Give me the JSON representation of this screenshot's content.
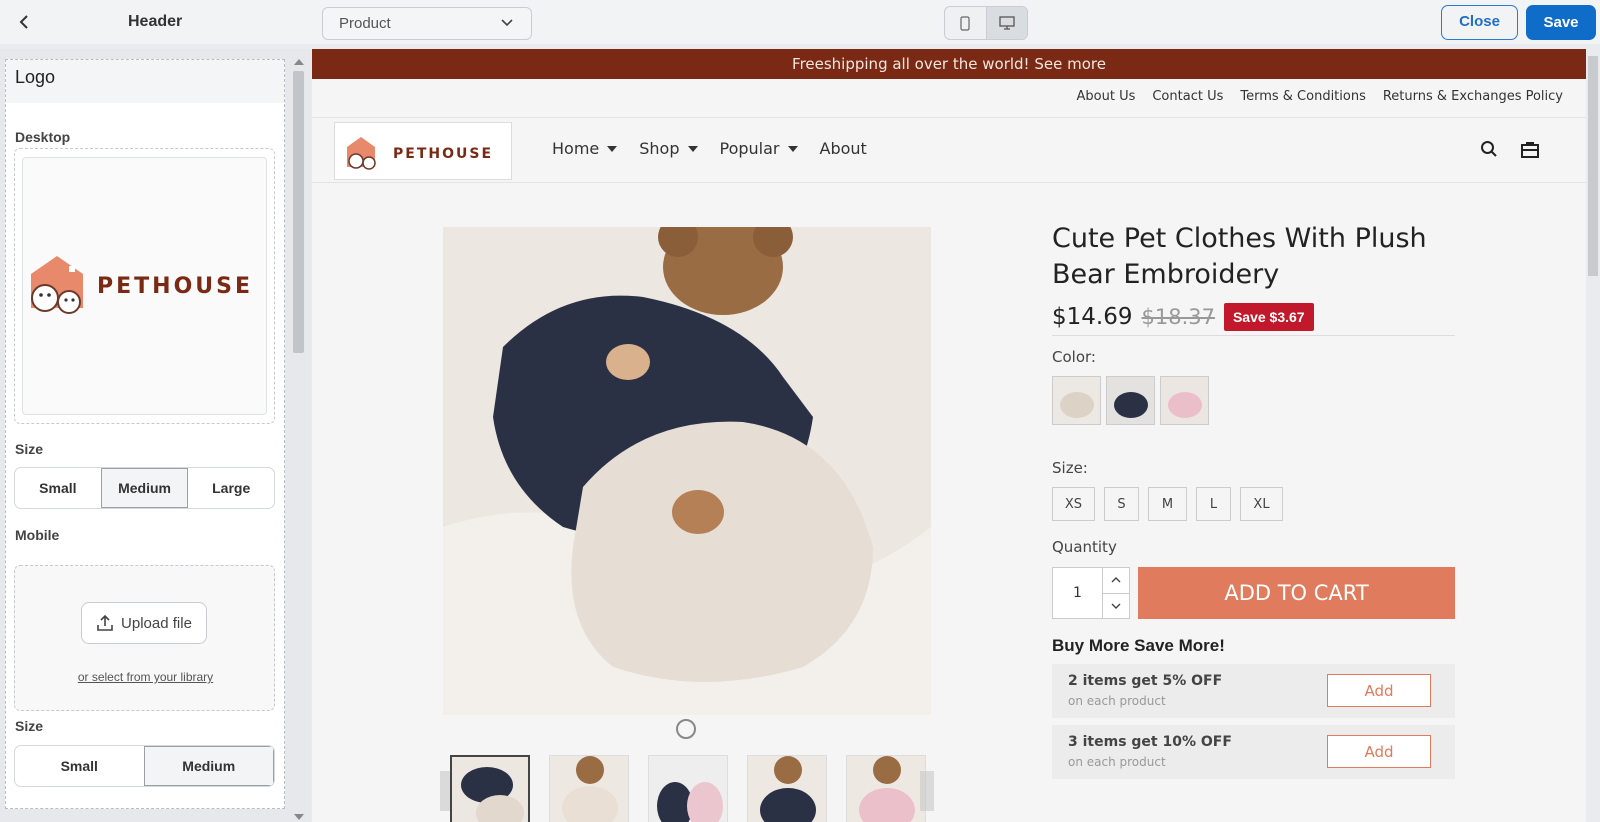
{
  "editor": {
    "title": "Header",
    "page_select": "Product",
    "close_label": "Close",
    "save_label": "Save"
  },
  "panel": {
    "section_title": "Logo",
    "desktop_label": "Desktop",
    "logo_text": "PETHOUSE",
    "size_label": "Size",
    "desktop_sizes": [
      "Small",
      "Medium",
      "Large"
    ],
    "desktop_size_selected": "Medium",
    "mobile_label": "Mobile",
    "upload_label": "Upload file",
    "library_link": "or select from your library",
    "mobile_size_label": "Size",
    "mobile_sizes": [
      "Small",
      "Medium"
    ],
    "mobile_size_selected": "Medium"
  },
  "store": {
    "announcement": "Freeshipping all over the world! See more",
    "util_links": [
      "About Us",
      "Contact Us",
      "Terms & Conditions",
      "Returns & Exchanges Policy"
    ],
    "logo_text": "PETHOUSE",
    "nav": [
      {
        "label": "Home",
        "dropdown": true
      },
      {
        "label": "Shop",
        "dropdown": true
      },
      {
        "label": "Popular",
        "dropdown": true
      },
      {
        "label": "About",
        "dropdown": false
      }
    ]
  },
  "product": {
    "title": "Cute Pet Clothes With Plush Bear Embroidery",
    "price": "$14.69",
    "compare_price": "$18.37",
    "save_badge": "Save $3.67",
    "color_label": "Color:",
    "colors": [
      "cream",
      "navy",
      "pink"
    ],
    "size_label": "Size:",
    "sizes": [
      "XS",
      "S",
      "M",
      "L",
      "XL"
    ],
    "quantity_label": "Quantity",
    "quantity": "1",
    "add_to_cart": "ADD TO CART",
    "bundle_title": "Buy More Save More!",
    "tiers": [
      {
        "title": "2 items get 5% OFF",
        "sub": "on each product",
        "button": "Add"
      },
      {
        "title": "3 items get 10% OFF",
        "sub": "on each product",
        "button": "Add"
      }
    ]
  },
  "colors": {
    "primary_blue": "#0f6cc9",
    "announcement_bg": "#7a2a14",
    "accent": "#e07b5d",
    "save_badge": "#c2182b"
  }
}
